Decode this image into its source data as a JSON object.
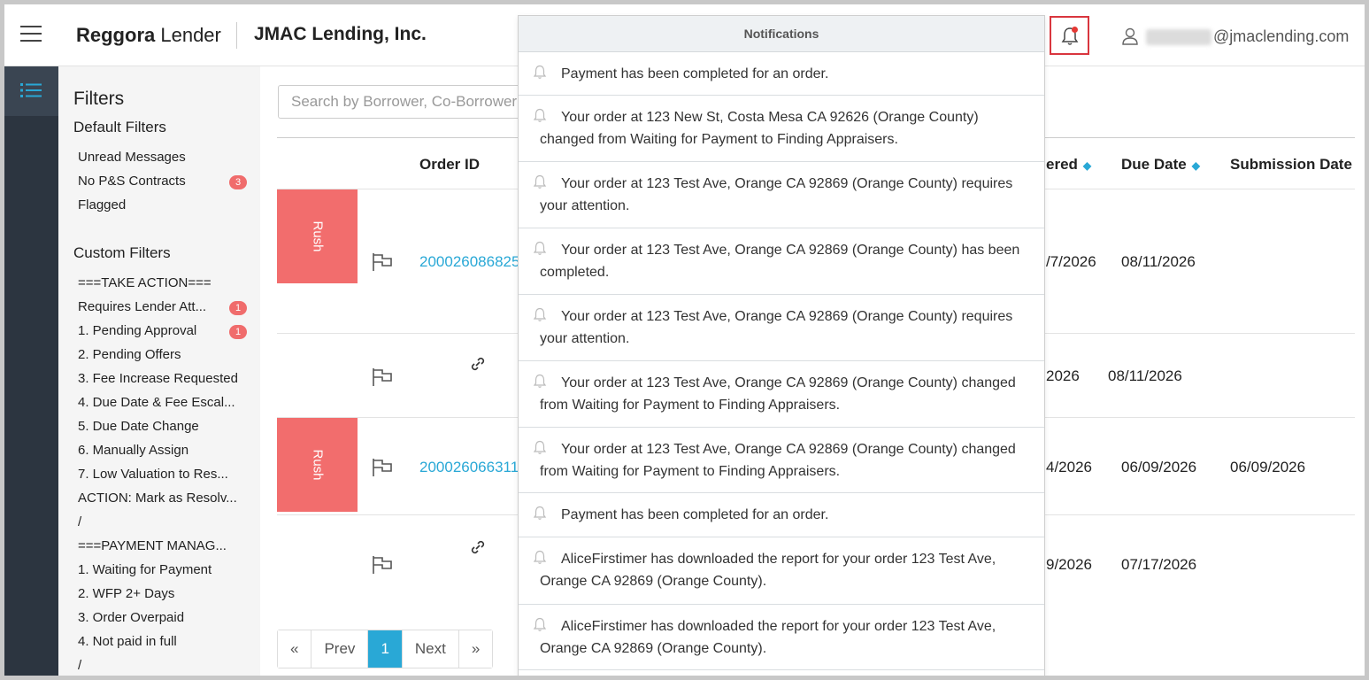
{
  "header": {
    "brand_bold": "Reggora",
    "brand_light": " Lender",
    "company": "JMAC Lending, Inc.",
    "user_email": "@jmaclending.com"
  },
  "filters": {
    "title": "Filters",
    "default_title": "Default Filters",
    "default_items": [
      {
        "label": "Unread Messages",
        "badge": ""
      },
      {
        "label": "No P&S Contracts",
        "badge": "3"
      },
      {
        "label": "Flagged",
        "badge": ""
      }
    ],
    "custom_title": "Custom Filters",
    "custom_items": [
      {
        "label": "===TAKE ACTION===",
        "badge": ""
      },
      {
        "label": "Requires Lender Att...",
        "badge": "1"
      },
      {
        "label": "1. Pending Approval",
        "badge": "1"
      },
      {
        "label": "2. Pending Offers",
        "badge": ""
      },
      {
        "label": "3. Fee Increase Requested",
        "badge": ""
      },
      {
        "label": "4. Due Date & Fee Escal...",
        "badge": ""
      },
      {
        "label": "5. Due Date Change",
        "badge": ""
      },
      {
        "label": "6. Manually Assign",
        "badge": ""
      },
      {
        "label": "7. Low Valuation to Res...",
        "badge": ""
      },
      {
        "label": "ACTION: Mark as Resolv...",
        "badge": ""
      },
      {
        "label": "/",
        "badge": ""
      },
      {
        "label": "===PAYMENT MANAG...",
        "badge": ""
      },
      {
        "label": "1. Waiting for Payment",
        "badge": ""
      },
      {
        "label": "2. WFP 2+ Days",
        "badge": ""
      },
      {
        "label": "3. Order Overpaid",
        "badge": ""
      },
      {
        "label": "4. Not paid in full",
        "badge": ""
      },
      {
        "label": "/",
        "badge": ""
      }
    ]
  },
  "search": {
    "placeholder": "Search by Borrower, Co-Borrower"
  },
  "table": {
    "col_order_id": "Order ID",
    "col_ordered": "ered",
    "col_due_date": "Due Date",
    "col_submission": "Submission Date",
    "rush_label": "Rush",
    "rows": [
      {
        "order_id": "200026086825",
        "ordered": "/7/2026",
        "due": "08/11/2026",
        "submitted": ""
      },
      {
        "order_id": "",
        "ordered": "2026",
        "due": "08/11/2026",
        "submitted": ""
      },
      {
        "order_id": "200026066311",
        "ordered": "4/2026",
        "due": "06/09/2026",
        "submitted": "06/09/2026"
      },
      {
        "order_id": "",
        "ordered": "9/2026",
        "due": "07/17/2026",
        "submitted": ""
      }
    ]
  },
  "pagination": {
    "first": "«",
    "prev": "Prev",
    "current": "1",
    "next": "Next",
    "last": "»"
  },
  "notifications": {
    "title": "Notifications",
    "items": [
      "Payment has been completed for an order.",
      "Your order at 123 New St, Costa Mesa CA 92626 (Orange County) changed from Waiting for Payment to Finding Appraisers.",
      "Your order at 123 Test Ave, Orange CA 92869 (Orange County) requires your attention.",
      "Your order at 123 Test Ave, Orange CA 92869 (Orange County) has been completed.",
      "Your order at 123 Test Ave, Orange CA 92869 (Orange County) requires your attention.",
      "Your order at 123 Test Ave, Orange CA 92869 (Orange County) changed from Waiting for Payment to Finding Appraisers.",
      "Your order at 123 Test Ave, Orange CA 92869 (Orange County) changed from Waiting for Payment to Finding Appraisers.",
      "Payment has been completed for an order.",
      "AliceFirstimer has downloaded the report for your order 123 Test Ave, Orange CA 92869 (Orange County).",
      "AliceFirstimer has downloaded the report for your order 123 Test Ave, Orange CA 92869 (Orange County)."
    ]
  },
  "colors": {
    "accent": "#29a8d6",
    "rush": "#f26d6d",
    "badge": "#f06c6c",
    "rail": "#2c3540",
    "highlight_border": "#d9363e"
  }
}
